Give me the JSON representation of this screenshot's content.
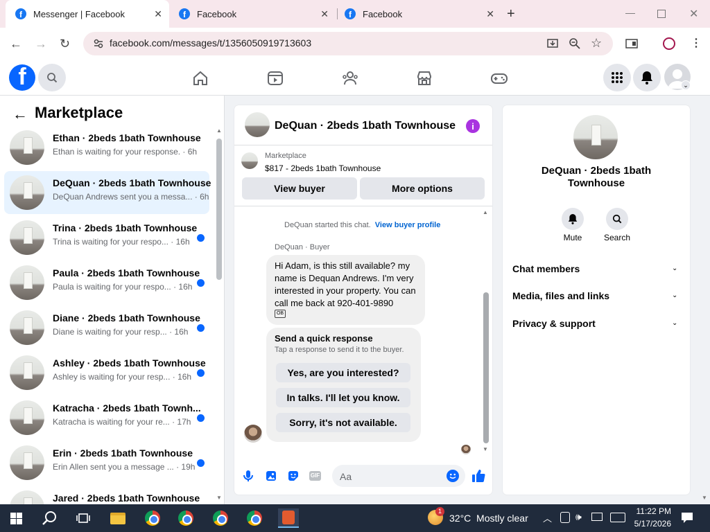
{
  "browser": {
    "tabs": [
      {
        "title": "Messenger | Facebook",
        "active": true
      },
      {
        "title": "Facebook",
        "active": false
      },
      {
        "title": "Facebook",
        "active": false
      }
    ],
    "url": "facebook.com/messages/t/1356050919713603"
  },
  "sidebar": {
    "title": "Marketplace",
    "conversations": [
      {
        "title": "Ethan · 2beds 1bath Townhouse",
        "subtitle": "Ethan is waiting for your response. · 6h",
        "unread": false,
        "selected": false
      },
      {
        "title": "DeQuan · 2beds 1bath Townhouse",
        "subtitle": "DeQuan Andrews sent you a messa... · 6h",
        "unread": false,
        "selected": true
      },
      {
        "title": "Trina · 2beds 1bath Townhouse",
        "subtitle": "Trina is waiting for your respo... · 16h",
        "unread": true,
        "selected": false
      },
      {
        "title": "Paula · 2beds 1bath Townhouse",
        "subtitle": "Paula is waiting for your respo... · 16h",
        "unread": true,
        "selected": false
      },
      {
        "title": "Diane · 2beds 1bath Townhouse",
        "subtitle": "Diane is waiting for your resp... · 16h",
        "unread": true,
        "selected": false
      },
      {
        "title": "Ashley · 2beds 1bath Townhouse",
        "subtitle": "Ashley is waiting for your resp... · 16h",
        "unread": true,
        "selected": false
      },
      {
        "title": "Katracha · 2beds 1bath Townh...",
        "subtitle": "Katracha is waiting for your re... · 17h",
        "unread": true,
        "selected": false
      },
      {
        "title": "Erin · 2beds 1bath Townhouse",
        "subtitle": "Erin Allen sent you a message ... · 19h",
        "unread": true,
        "selected": false
      },
      {
        "title": "Jared · 2beds 1bath Townhouse",
        "subtitle": "",
        "unread": false,
        "selected": false
      }
    ]
  },
  "chat": {
    "header_title": "DeQuan · 2beds 1bath Townhouse",
    "listing_label": "Marketplace",
    "listing_price": "$817 - 2beds 1bath Townhouse",
    "view_buyer": "View buyer",
    "more_options": "More options",
    "started_text": "DeQuan started this chat.",
    "view_buyer_profile": "View buyer profile",
    "sender_label": "DeQuan · Buyer",
    "message": "Hi Adam, is this still available? my name is Dequan Andrews. I'm very interested in your property. You can call me back at 920-401-9890",
    "quick_title": "Send a quick response",
    "quick_sub": "Tap a response to send it to the buyer.",
    "quick_responses": [
      "Yes, are you interested?",
      "In talks. I'll let you know.",
      "Sorry, it's not available."
    ],
    "input_placeholder": "Aa"
  },
  "details": {
    "title": "DeQuan · 2beds 1bath Townhouse",
    "mute": "Mute",
    "search": "Search",
    "sections": [
      "Chat members",
      "Media, files and links",
      "Privacy & support"
    ]
  },
  "taskbar": {
    "weather": "32°C  Mostly clear",
    "time": "11:22 PM",
    "date": "5/17/2026",
    "badge": "1"
  },
  "colors": {
    "accent": "#0866ff",
    "info": "#a933e0",
    "tabbar": "#f7e7ec",
    "taskbar": "#202b3c"
  }
}
